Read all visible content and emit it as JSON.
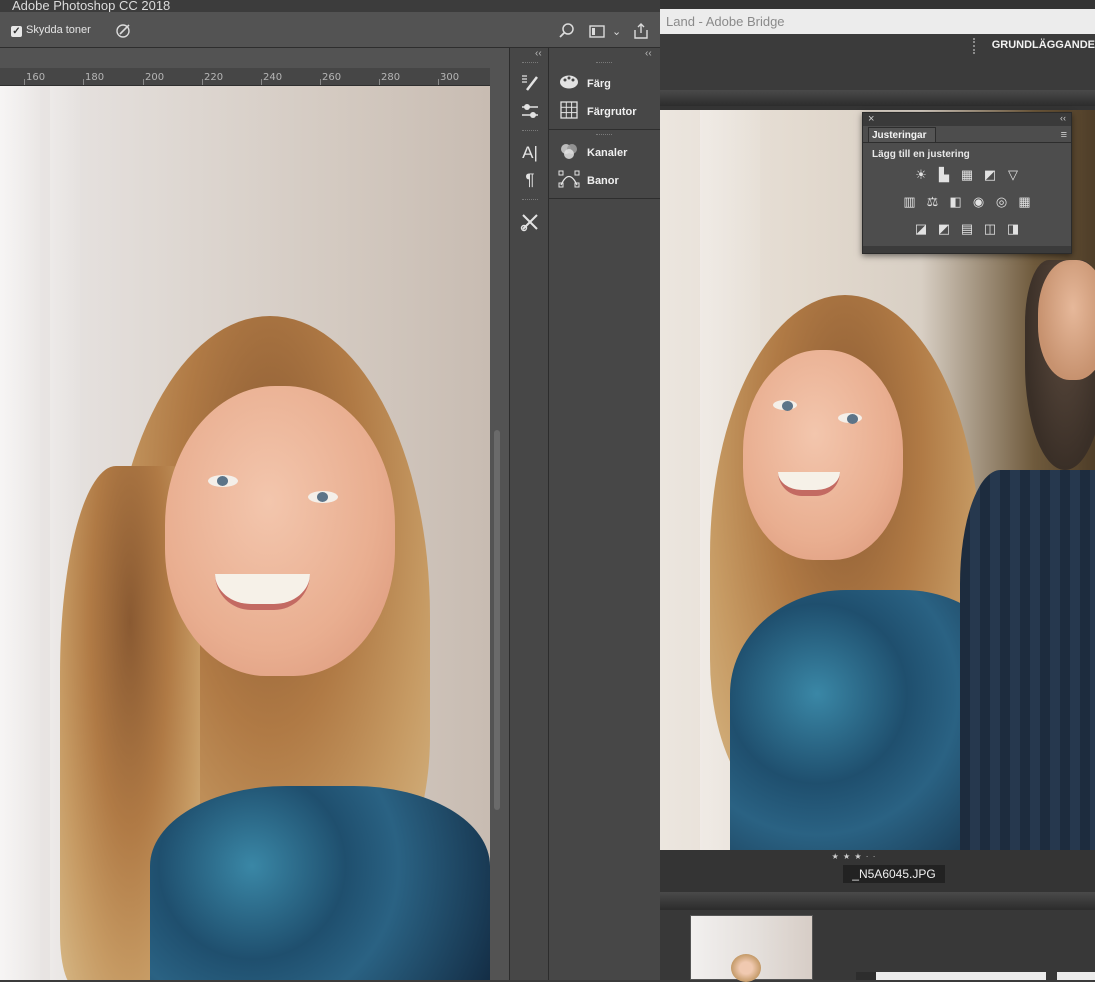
{
  "photoshop": {
    "window_title": "Adobe Photoshop CC 2018",
    "options_bar": {
      "protect_tones_checked": true,
      "protect_tones_label": "Skydda toner",
      "icons": [
        "brush-pressure-icon",
        "search-icon",
        "workspace-icon",
        "chevron-down-icon",
        "share-icon"
      ]
    },
    "ruler": {
      "ticks": [
        "160",
        "180",
        "200",
        "220",
        "240",
        "260",
        "280",
        "300"
      ]
    },
    "toolstrip": {
      "icons": [
        "brush-presets-icon",
        "adjustments-icon",
        "character-icon",
        "paragraph-icon",
        "tools-icon"
      ]
    },
    "panels": {
      "items": [
        {
          "label": "Färg",
          "icon": "color-palette-icon"
        },
        {
          "label": "Färgrutor",
          "icon": "swatches-grid-icon"
        },
        {
          "label": "Kanaler",
          "icon": "channels-icon"
        },
        {
          "label": "Banor",
          "icon": "paths-icon"
        }
      ]
    }
  },
  "bridge": {
    "window_title": "Land - Adobe Bridge",
    "workspace_label": "GRUNDLÄGGANDE",
    "adjustments_panel": {
      "tab_label": "Justeringar",
      "subtitle": "Lägg till en justering",
      "row1": [
        "☀",
        "▙",
        "▦",
        "◩",
        "▽"
      ],
      "row2": [
        "▥",
        "⚖",
        "◧",
        "◉",
        "◎",
        "▦"
      ],
      "row3": [
        "◪",
        "◩",
        "▤",
        "◫",
        "◨"
      ]
    },
    "rating_stars": "★ ★ ★ · ·",
    "filename": "_N5A6045.JPG"
  }
}
